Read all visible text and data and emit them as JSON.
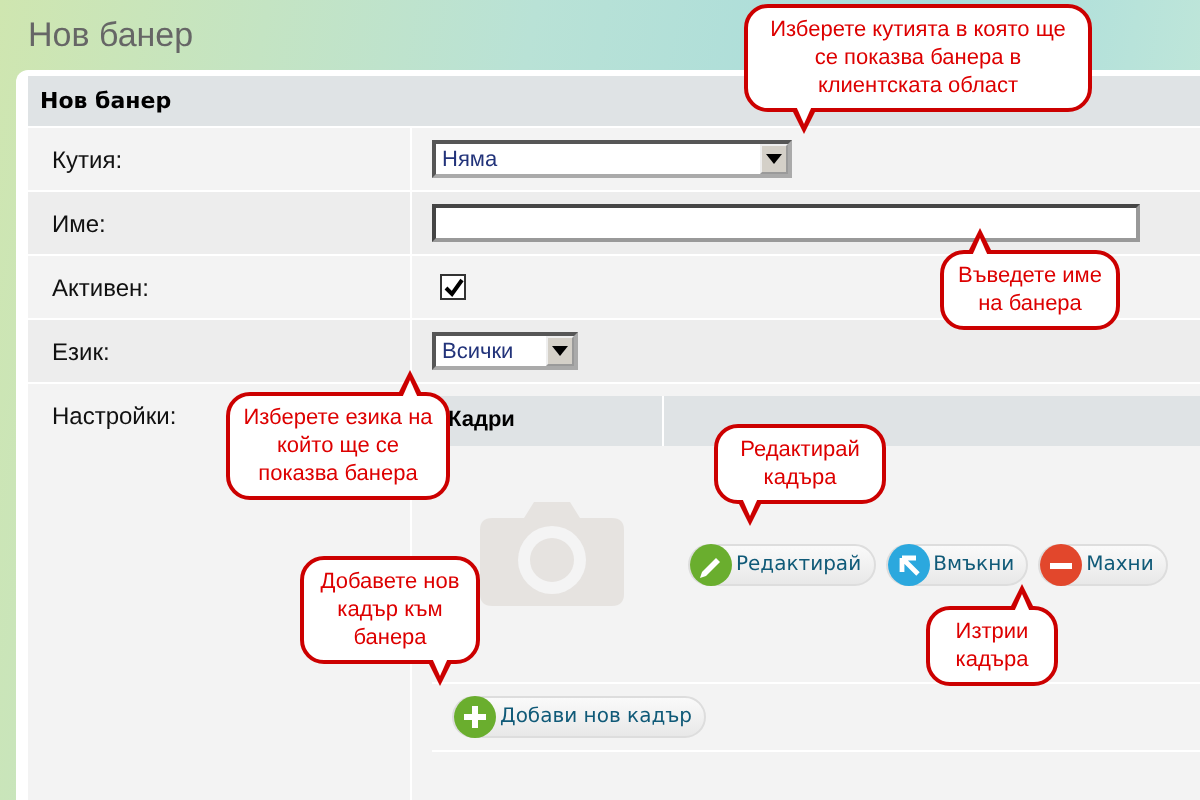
{
  "page_title": "Нов банер",
  "panel": {
    "title": "Нов банер",
    "fields": [
      {
        "kind": "select",
        "label": "Кутия:",
        "value": "Няма"
      },
      {
        "kind": "text",
        "label": "Име:"
      },
      {
        "kind": "checkbox",
        "label": "Активен:",
        "checked": true
      },
      {
        "kind": "select",
        "label": "Език:",
        "value": "Всички"
      }
    ],
    "settings": {
      "label": "Настройки:",
      "frames": {
        "columns": [
          "Кадри"
        ],
        "buttons": [
          {
            "kind": "edit",
            "label": "Редактирай"
          },
          {
            "kind": "insert",
            "label": "Вмъкни"
          },
          {
            "kind": "remove",
            "label": "Махни"
          }
        ],
        "add_button": "Добави нов кадър"
      }
    }
  },
  "callouts": [
    {
      "text": "Изберете кутията в която ще се показва банера в клиентската област"
    },
    {
      "text": "Въведете име на банера"
    },
    {
      "text": "Изберете езика на който ще се показва банера"
    },
    {
      "text": "Редактирай кадъра"
    },
    {
      "text": "Изтрии кадъра"
    },
    {
      "text": "Добавете нов кадър към банера"
    }
  ]
}
